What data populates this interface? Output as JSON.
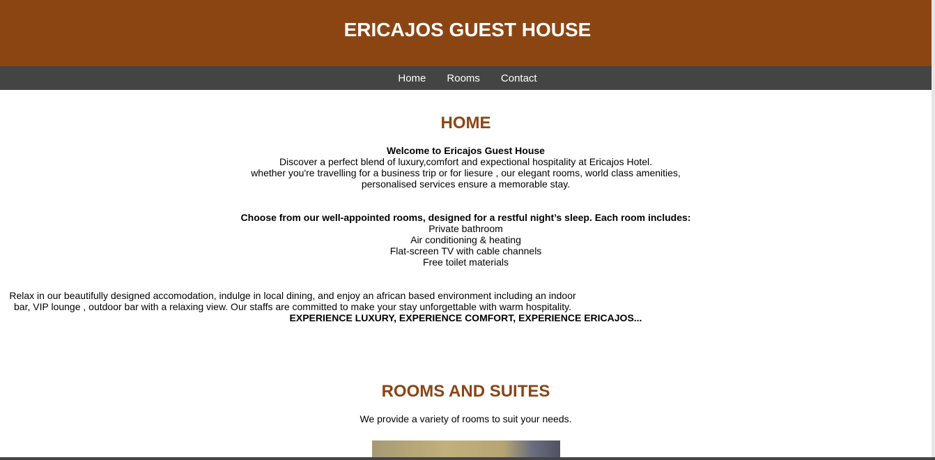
{
  "header": {
    "title": "ERICAJOS GUEST HOUSE"
  },
  "nav": {
    "items": [
      "Home",
      "Rooms",
      "Contact"
    ]
  },
  "home": {
    "title": "HOME",
    "welcome_heading": "Welcome to Ericajos Guest House",
    "welcome_lines": [
      "Discover a perfect blend of luxury,comfort and expectional hospitality at Ericajos Hotel.",
      "whether you're travelling for a business trip or for liesure , our elegant rooms, world class amenities,",
      "personalised services ensure a memorable stay."
    ],
    "rooms_intro": "Choose from our well-appointed rooms, designed for a restful night’s sleep. Each room includes:",
    "amenities": [
      "Private bathroom",
      "Air conditioning & heating",
      "Flat-screen TV with cable channels",
      "Free toilet materials"
    ],
    "relax_text": "Relax in our beautifully designed accomodation, indulge in local dining, and enjoy an african based environment including an indoor bar, VIP lounge , outdoor bar with a relaxing view. Our staffs are committed to make your stay unforgettable with warm hospitality.",
    "tagline": "EXPERIENCE LUXURY, EXPERIENCE COMFORT, EXPERIENCE ERICAJOS..."
  },
  "rooms": {
    "title": "ROOMS AND SUITES",
    "subtitle": "We provide a variety of rooms to suit your needs."
  }
}
